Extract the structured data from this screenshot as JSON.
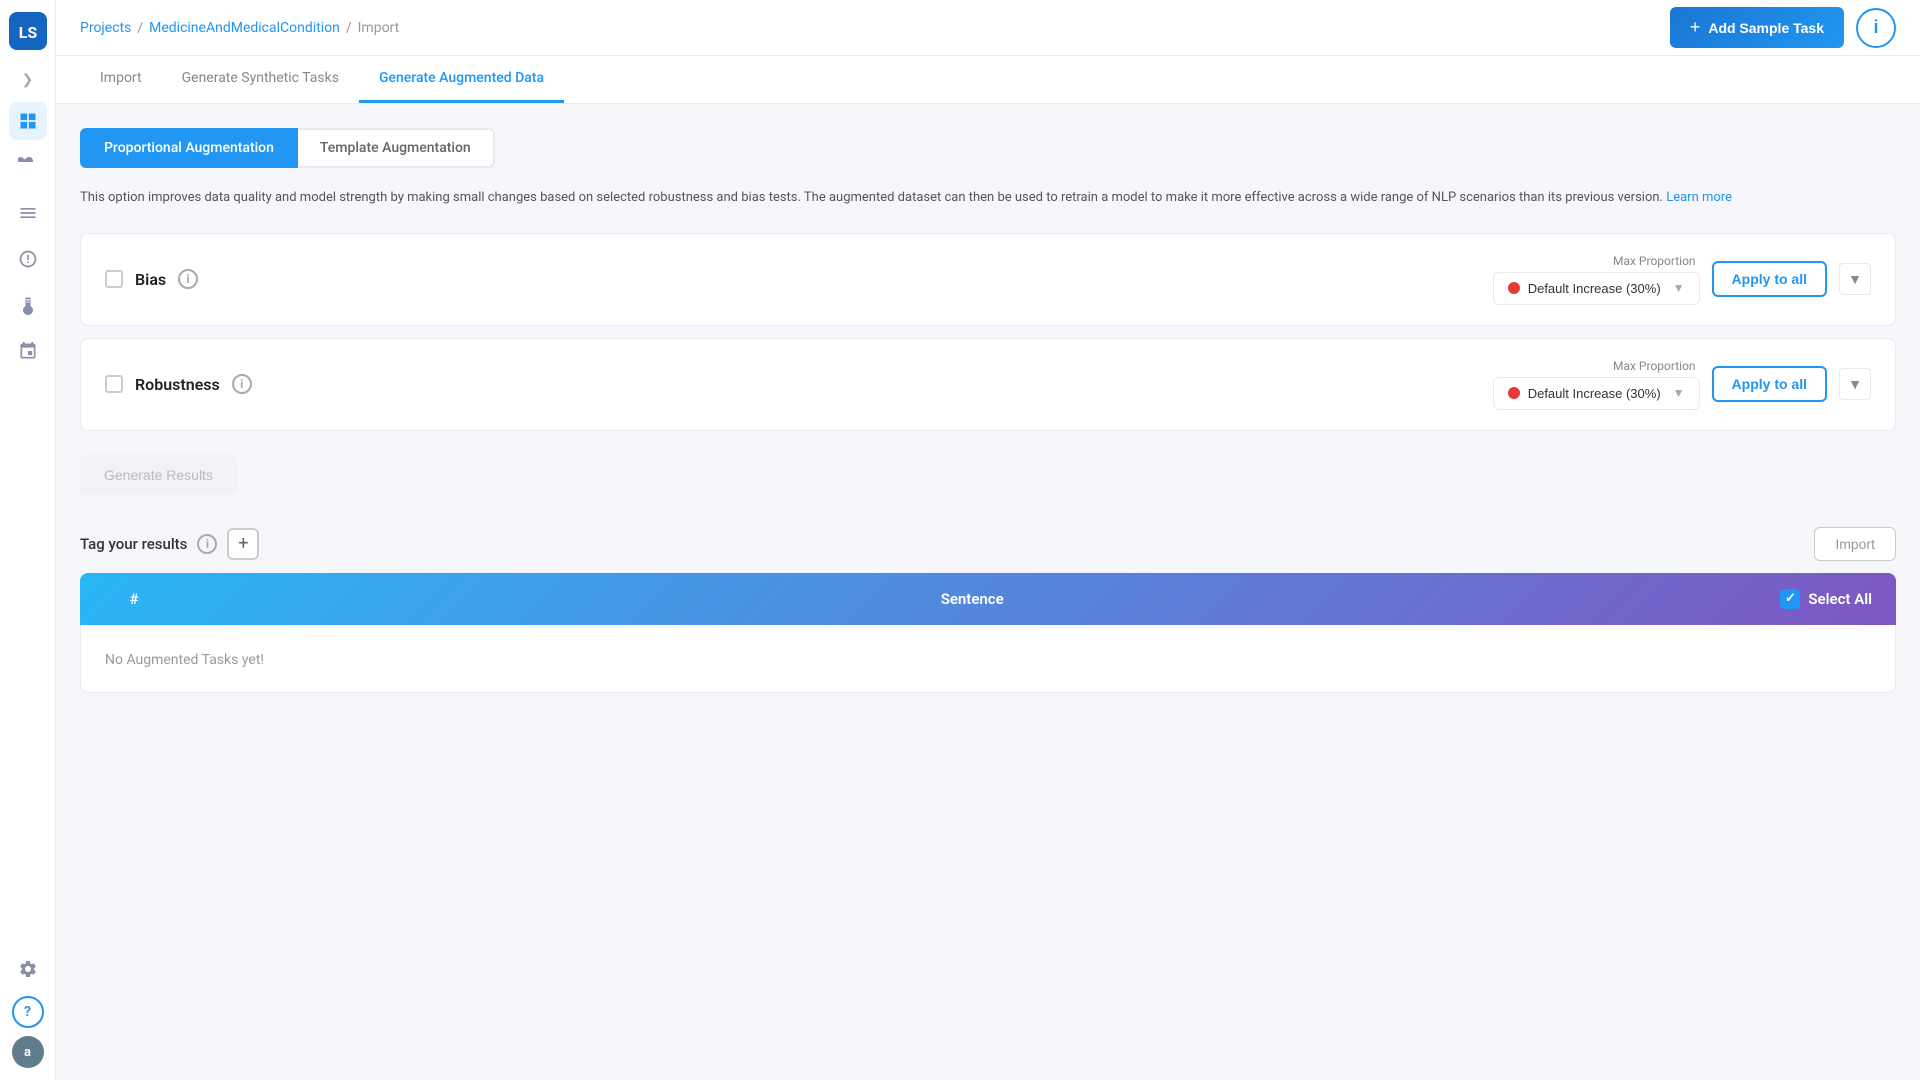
{
  "sidebar": {
    "logo_text": "LS",
    "chevron": "❯",
    "icons": [
      {
        "name": "dashboard-icon",
        "glyph": "⊞"
      },
      {
        "name": "projects-icon",
        "glyph": "◫"
      },
      {
        "name": "tasks-icon",
        "glyph": "☰"
      },
      {
        "name": "explore-icon",
        "glyph": "◎"
      },
      {
        "name": "experiments-icon",
        "glyph": "⚗"
      },
      {
        "name": "integrations-icon",
        "glyph": "⚙"
      },
      {
        "name": "settings-icon",
        "glyph": "⚙"
      }
    ],
    "help_label": "?",
    "avatar_label": "a"
  },
  "topbar": {
    "breadcrumb_projects": "Projects",
    "breadcrumb_separator1": "/",
    "breadcrumb_project": "MedicineAndMedicalCondition",
    "breadcrumb_separator2": "/",
    "breadcrumb_current": "Import",
    "add_sample_label": "Add Sample Task",
    "info_label": "i"
  },
  "nav": {
    "tabs": [
      {
        "id": "import",
        "label": "Import"
      },
      {
        "id": "generate-synthetic",
        "label": "Generate Synthetic Tasks"
      },
      {
        "id": "generate-augmented",
        "label": "Generate Augmented Data"
      }
    ],
    "active": "generate-augmented"
  },
  "sub_tabs": {
    "tabs": [
      {
        "id": "proportional",
        "label": "Proportional Augmentation"
      },
      {
        "id": "template",
        "label": "Template Augmentation"
      }
    ],
    "active": "proportional"
  },
  "description": {
    "text": "This option improves data quality and model strength by making small changes based on selected robustness and bias tests. The augmented dataset can then be used to retrain a model to make it more effective across a wide range of NLP scenarios than its previous version.",
    "learn_more": "Learn more"
  },
  "bias_section": {
    "title": "Bias",
    "max_proportion_label": "Max Proportion",
    "dropdown_label": "Default Increase (30%)",
    "apply_label": "Apply to all"
  },
  "robustness_section": {
    "title": "Robustness",
    "max_proportion_label": "Max Proportion",
    "dropdown_label": "Default Increase (30%)",
    "apply_label": "Apply to all"
  },
  "generate_btn": {
    "label": "Generate Results"
  },
  "tag_section": {
    "label": "Tag your results",
    "plus_label": "+",
    "import_label": "Import"
  },
  "table": {
    "col_hash": "#",
    "col_sentence": "Sentence",
    "select_all": "Select All",
    "empty_message": "No Augmented Tasks yet!"
  },
  "colors": {
    "accent": "#2196f3",
    "dot_red": "#e53935",
    "gradient_start": "#29b6f6",
    "gradient_end": "#7e57c2"
  }
}
